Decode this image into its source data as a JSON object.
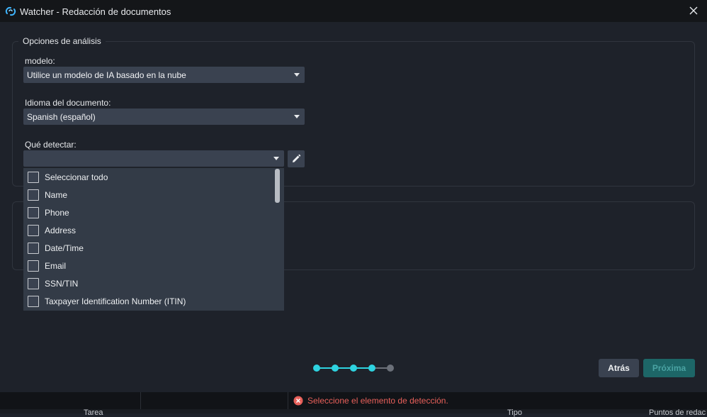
{
  "window": {
    "title": "Watcher - Redacción de documentos",
    "icons": {
      "logo": "watcher-logo-icon",
      "close": "close-icon"
    }
  },
  "analysis": {
    "group_title": "Opciones de análisis",
    "model_label": "modelo:",
    "model_value": "Utilice un modelo de IA basado en la nube",
    "language_label": "Idioma del documento:",
    "language_value": "Spanish (español)",
    "detect_label": "Qué detectar:",
    "detect_value": "",
    "detect_items": [
      {
        "label": "Seleccionar todo",
        "checked": false
      },
      {
        "label": "Name",
        "checked": false
      },
      {
        "label": "Phone",
        "checked": false
      },
      {
        "label": "Address",
        "checked": false
      },
      {
        "label": "Date/Time",
        "checked": false
      },
      {
        "label": "Email",
        "checked": false
      },
      {
        "label": "SSN/TIN",
        "checked": false
      },
      {
        "label": "Taxpayer Identification Number (ITIN)",
        "checked": false
      }
    ]
  },
  "stepper": {
    "total_steps": 5,
    "completed_steps": 4
  },
  "buttons": {
    "back": "Atrás",
    "next": "Próxima"
  },
  "status": {
    "message": "Seleccione el elemento de detección."
  },
  "table_headers": [
    "Tarea",
    "Tipo",
    "Puntos de redac"
  ],
  "colors": {
    "accent": "#2ed3e0",
    "error": "#e8605a",
    "next_button": "#1d6667",
    "background": "#1e222a"
  }
}
